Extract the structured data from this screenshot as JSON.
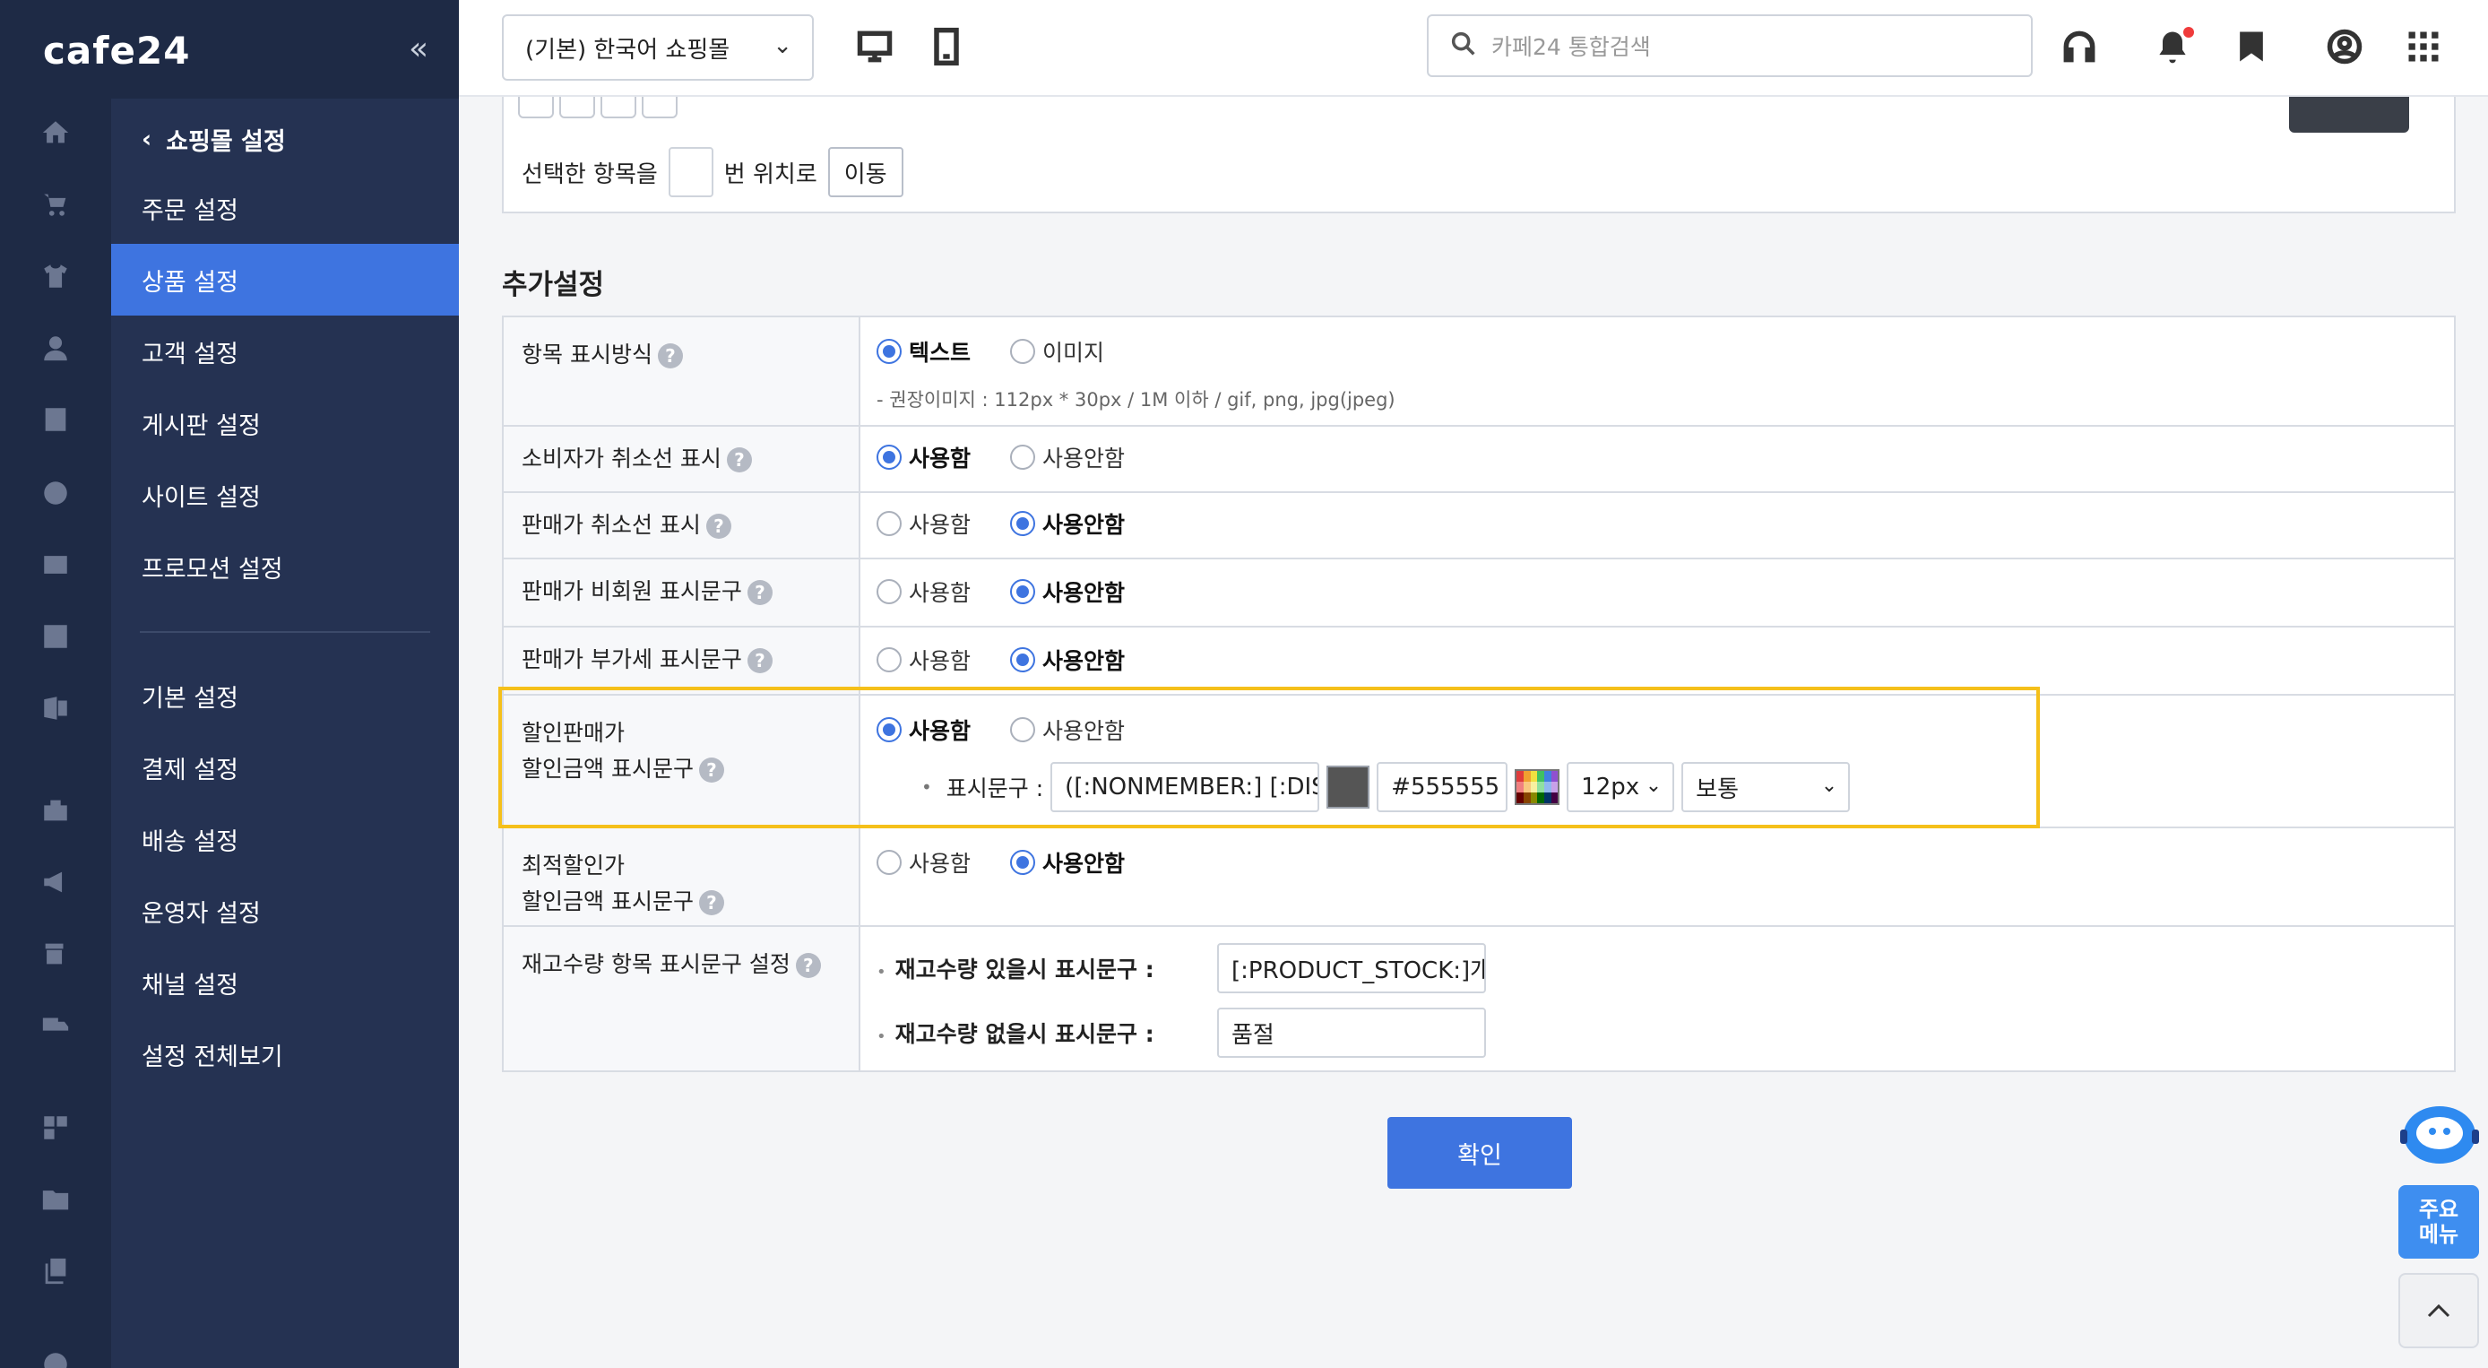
{
  "app": {
    "logo": "cafe24",
    "collapse_icon": "«"
  },
  "rail": {
    "icons": [
      "home-icon",
      "cart-icon",
      "shirt-icon",
      "user-icon",
      "board-icon",
      "palette-icon",
      "promo-icon",
      "stats-icon",
      "excel-icon",
      "app-icon",
      "megaphone-icon",
      "store-add-icon",
      "truck-icon",
      "apps-add-icon",
      "folder-add-icon",
      "copy-icon",
      "settings-icon"
    ]
  },
  "submenu": {
    "back_label": "쇼핑몰 설정",
    "group1": [
      "주문 설정",
      "상품 설정",
      "고객 설정",
      "게시판 설정",
      "사이트 설정",
      "프로모션 설정"
    ],
    "group2": [
      "기본 설정",
      "결제 설정",
      "배송 설정",
      "운영자 설정",
      "채널 설정",
      "설정 전체보기"
    ],
    "active": "상품 설정"
  },
  "header": {
    "mall_select": "(기본) 한국어 쇼핑몰",
    "search_placeholder": "카페24 통합검색"
  },
  "move": {
    "label_before": "선택한 항목을",
    "label_after": "번 위치로",
    "button": "이동"
  },
  "section_title": "추가설정",
  "rows": {
    "display_mode": {
      "label": "항목 표시방식",
      "opt1": "텍스트",
      "opt2": "이미지",
      "hint": "- 권장이미지 : 112px * 30px / 1M 이하 / gif, png, jpg(jpeg)"
    },
    "consumer_strike": {
      "label": "소비자가 취소선 표시",
      "opt1": "사용함",
      "opt2": "사용안함"
    },
    "seller_strike": {
      "label": "판매가 취소선 표시",
      "opt1": "사용함",
      "opt2": "사용안함"
    },
    "seller_nonmember": {
      "label": "판매가 비회원 표시문구",
      "opt1": "사용함",
      "opt2": "사용안함"
    },
    "seller_vat": {
      "label": "판매가 부가세 표시문구",
      "opt1": "사용함",
      "opt2": "사용안함"
    },
    "discount_text": {
      "label1": "할인판매가",
      "label2": "할인금액 표시문구",
      "opt1": "사용함",
      "opt2": "사용안함",
      "field_label": "표시문구 :",
      "text_value": "([:NONMEMBER:] [:DISC",
      "color_value": "#555555",
      "size_value": "12px",
      "weight_value": "보통"
    },
    "best_discount": {
      "label1": "최적할인가",
      "label2": "할인금액 표시문구",
      "opt1": "사용함",
      "opt2": "사용안함"
    },
    "stock_text": {
      "label": "재고수량 항목 표시문구 설정",
      "in_stock_label": "재고수량 있을시 표시문구 :",
      "in_stock_value": "[:PRODUCT_STOCK:]개",
      "out_stock_label": "재고수량 없을시 표시문구 :",
      "out_stock_value": "품절"
    }
  },
  "confirm_button": "확인",
  "floating": {
    "main_menu": "주요\n메뉴"
  },
  "colors": {
    "accent": "#3e74e0",
    "sidebar": "#1e2a45",
    "highlight": "#f5c01a"
  }
}
